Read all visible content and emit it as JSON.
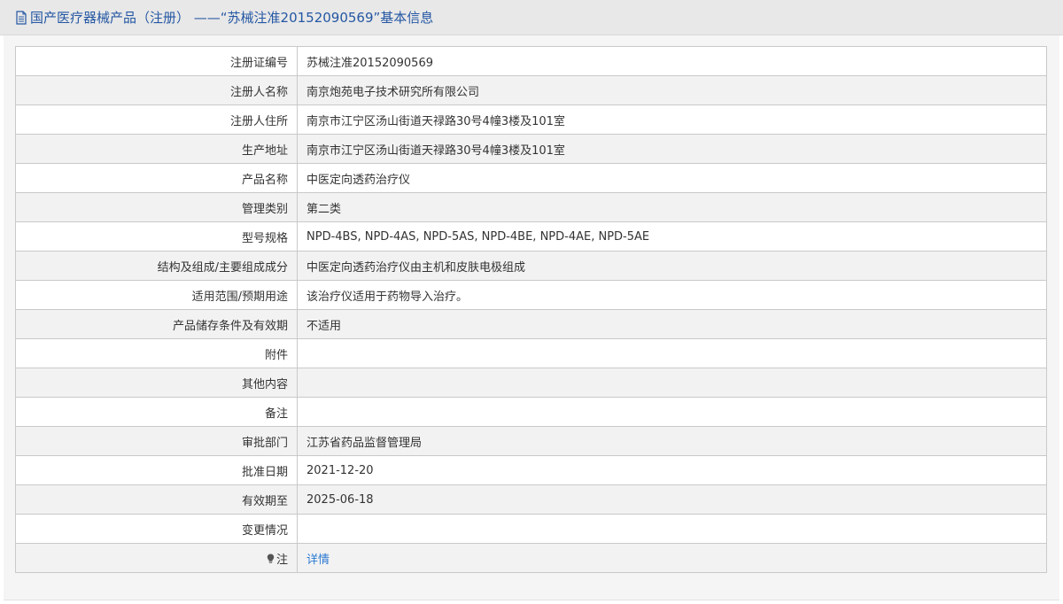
{
  "header": {
    "title": "国产医疗器械产品（注册）  ——“苏械注准20152090569”基本信息",
    "icon": "document-icon"
  },
  "rows": [
    {
      "label": "注册证编号",
      "value": "苏械注准20152090569"
    },
    {
      "label": "注册人名称",
      "value": "南京炮苑电子技术研究所有限公司"
    },
    {
      "label": "注册人住所",
      "value": "南京市江宁区汤山街道天禄路30号4幢3楼及101室"
    },
    {
      "label": "生产地址",
      "value": "南京市江宁区汤山街道天禄路30号4幢3楼及101室"
    },
    {
      "label": "产品名称",
      "value": "中医定向透药治疗仪"
    },
    {
      "label": "管理类别",
      "value": "第二类"
    },
    {
      "label": "型号规格",
      "value": "NPD-4BS, NPD-4AS, NPD-5AS, NPD-4BE, NPD-4AE, NPD-5AE"
    },
    {
      "label": "结构及组成/主要组成成分",
      "value": "中医定向透药治疗仪由主机和皮肤电极组成"
    },
    {
      "label": "适用范围/预期用途",
      "value": "该治疗仪适用于药物导入治疗。"
    },
    {
      "label": "产品储存条件及有效期",
      "value": "不适用"
    },
    {
      "label": "附件",
      "value": ""
    },
    {
      "label": "其他内容",
      "value": ""
    },
    {
      "label": "备注",
      "value": ""
    },
    {
      "label": "审批部门",
      "value": "江苏省药品监督管理局"
    },
    {
      "label": "批准日期",
      "value": "2021-12-20"
    },
    {
      "label": "有效期至",
      "value": "2025-06-18"
    },
    {
      "label": "变更情况",
      "value": ""
    }
  ],
  "note_row": {
    "label": "注",
    "icon": "lightbulb-icon",
    "link_text": "详情"
  },
  "colors": {
    "title_text": "#2457a3",
    "link": "#2a7ad2",
    "border": "#c9c9c9"
  }
}
